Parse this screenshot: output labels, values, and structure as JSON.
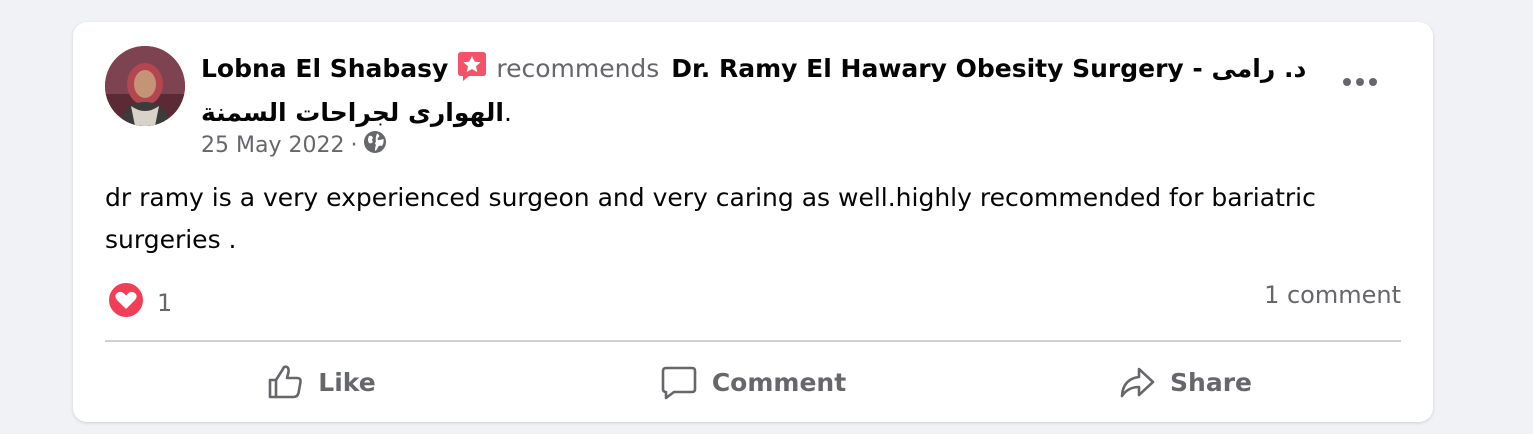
{
  "post": {
    "author": "Lobna El Shabasy",
    "recommends_text": "recommends",
    "page_name": "Dr. Ramy El Hawary Obesity Surgery - د. رامى الهوارى لجراحات السمنة",
    "page_suffix": ".",
    "date": "25 May 2022",
    "date_separator": "·",
    "audience_icon": "globe-icon",
    "badge_icon": "recommendation-star-icon",
    "body": "dr ramy is a very experienced surgeon and very caring as well.highly recommended for bariatric surgeries ."
  },
  "reactions": {
    "icon": "love-reaction-icon",
    "count": "1",
    "comments": "1 comment"
  },
  "actions": {
    "like": "Like",
    "comment": "Comment",
    "share": "Share"
  },
  "colors": {
    "background": "#f0f2f5",
    "card": "#ffffff",
    "secondary_text": "#65676b",
    "love_red": "#f33e58",
    "badge_pink": "#f35369"
  }
}
